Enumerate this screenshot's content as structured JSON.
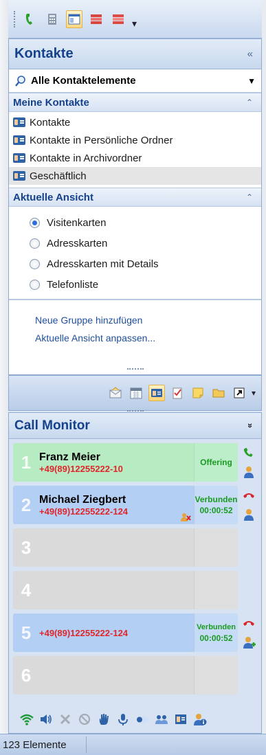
{
  "nav_pane": {
    "title": "Kontakte",
    "collapse_glyph": "«",
    "dropdown_label": "Alle Kontaktelemente",
    "my_contacts": {
      "header": "Meine Kontakte",
      "items": [
        {
          "label": "Kontakte"
        },
        {
          "label": "Kontakte in Persönliche Ordner"
        },
        {
          "label": "Kontakte in Archivordner"
        },
        {
          "label": "Geschäftlich"
        }
      ]
    },
    "current_view": {
      "header": "Aktuelle Ansicht",
      "options": [
        {
          "label": "Visitenkarten",
          "checked": true
        },
        {
          "label": "Adresskarten",
          "checked": false
        },
        {
          "label": "Adresskarten mit Details",
          "checked": false
        },
        {
          "label": "Telefonliste",
          "checked": false
        }
      ]
    },
    "links": {
      "add_group": "Neue Gruppe hinzufügen",
      "customize_view": "Aktuelle Ansicht anpassen..."
    }
  },
  "call_monitor": {
    "title": "Call Monitor",
    "chevron": "»",
    "lines": [
      {
        "number": "1",
        "name": "Franz Meier",
        "phone": "+49(89)12255222-10",
        "status": "Offering",
        "duration": "",
        "state": "offering"
      },
      {
        "number": "2",
        "name": "Michael Ziegbert",
        "phone": "+49(89)12255222-124",
        "status": "Verbunden",
        "duration": "00:00:52",
        "state": "connected"
      },
      {
        "number": "3",
        "name": "",
        "phone": "",
        "status": "",
        "duration": "",
        "state": "empty"
      },
      {
        "number": "4",
        "name": "",
        "phone": "",
        "status": "",
        "duration": "",
        "state": "empty"
      },
      {
        "number": "5",
        "name": "",
        "phone": "+49(89)12255222-124",
        "status": "Verbunden",
        "duration": "00:00:52",
        "state": "connected"
      },
      {
        "number": "6",
        "name": "",
        "phone": "",
        "status": "",
        "duration": "",
        "state": "empty"
      }
    ]
  },
  "status_bar": {
    "item_count": "123 Elemente"
  },
  "colors": {
    "header_text": "#15428b",
    "offering_bg": "#b7ecc2",
    "connected_bg": "#b3d0f4",
    "empty_bg": "#dadada",
    "phone_text": "#e0262a",
    "status_text": "#1a9a20"
  }
}
